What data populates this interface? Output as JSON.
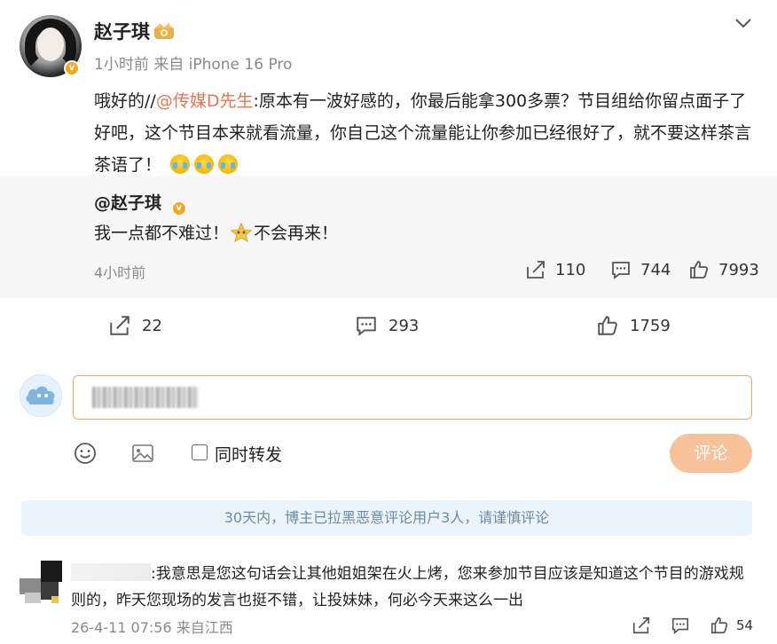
{
  "post": {
    "user_name": "赵子琪",
    "meta": "1小时前 来自 iPhone 16 Pro",
    "text_prefix": "哦好的//",
    "mention": "@传媒D先生",
    "text_body": ":原本有一波好感的，你最后能拿300多票？节目组给你留点面子了好吧，这个节目本来就看流量，你自己这个流量能让你参加已经很好了，就不要这样茶言茶语了！"
  },
  "quoted": {
    "user_name": "@赵子琪",
    "text_a": "我一点都不难过！",
    "text_b": "不会再来！",
    "time": "4小时前",
    "repost_count": "110",
    "comment_count": "744",
    "like_count": "7993"
  },
  "actions": {
    "repost_count": "22",
    "comment_count": "293",
    "like_count": "1759"
  },
  "composer": {
    "repost_label": "同时转发",
    "submit_label": "评论"
  },
  "notice": "30天内，博主已拉黑恶意评论用户3人，请谨慎评论",
  "comment": {
    "text": ":我意思是您这句话会让其他姐姐架在火上烤，您来参加节目应该是知道这个节目的游戏规则的，昨天您现场的发言也挺不错，让投妹妹，何必今天来这么一出",
    "meta": "26-4-11 07:56 来自江西",
    "like_count": "54"
  },
  "colors": {
    "accent": "#eb7350",
    "submit_disabled": "#f7c29a",
    "notice_bg": "#ecf4fb",
    "verify": "#f5a623"
  },
  "icons": [
    "chevron-down-icon",
    "crown-icon",
    "verified-icon",
    "repost-icon",
    "comment-icon",
    "like-icon",
    "emoji-icon",
    "image-icon",
    "share-icon"
  ]
}
